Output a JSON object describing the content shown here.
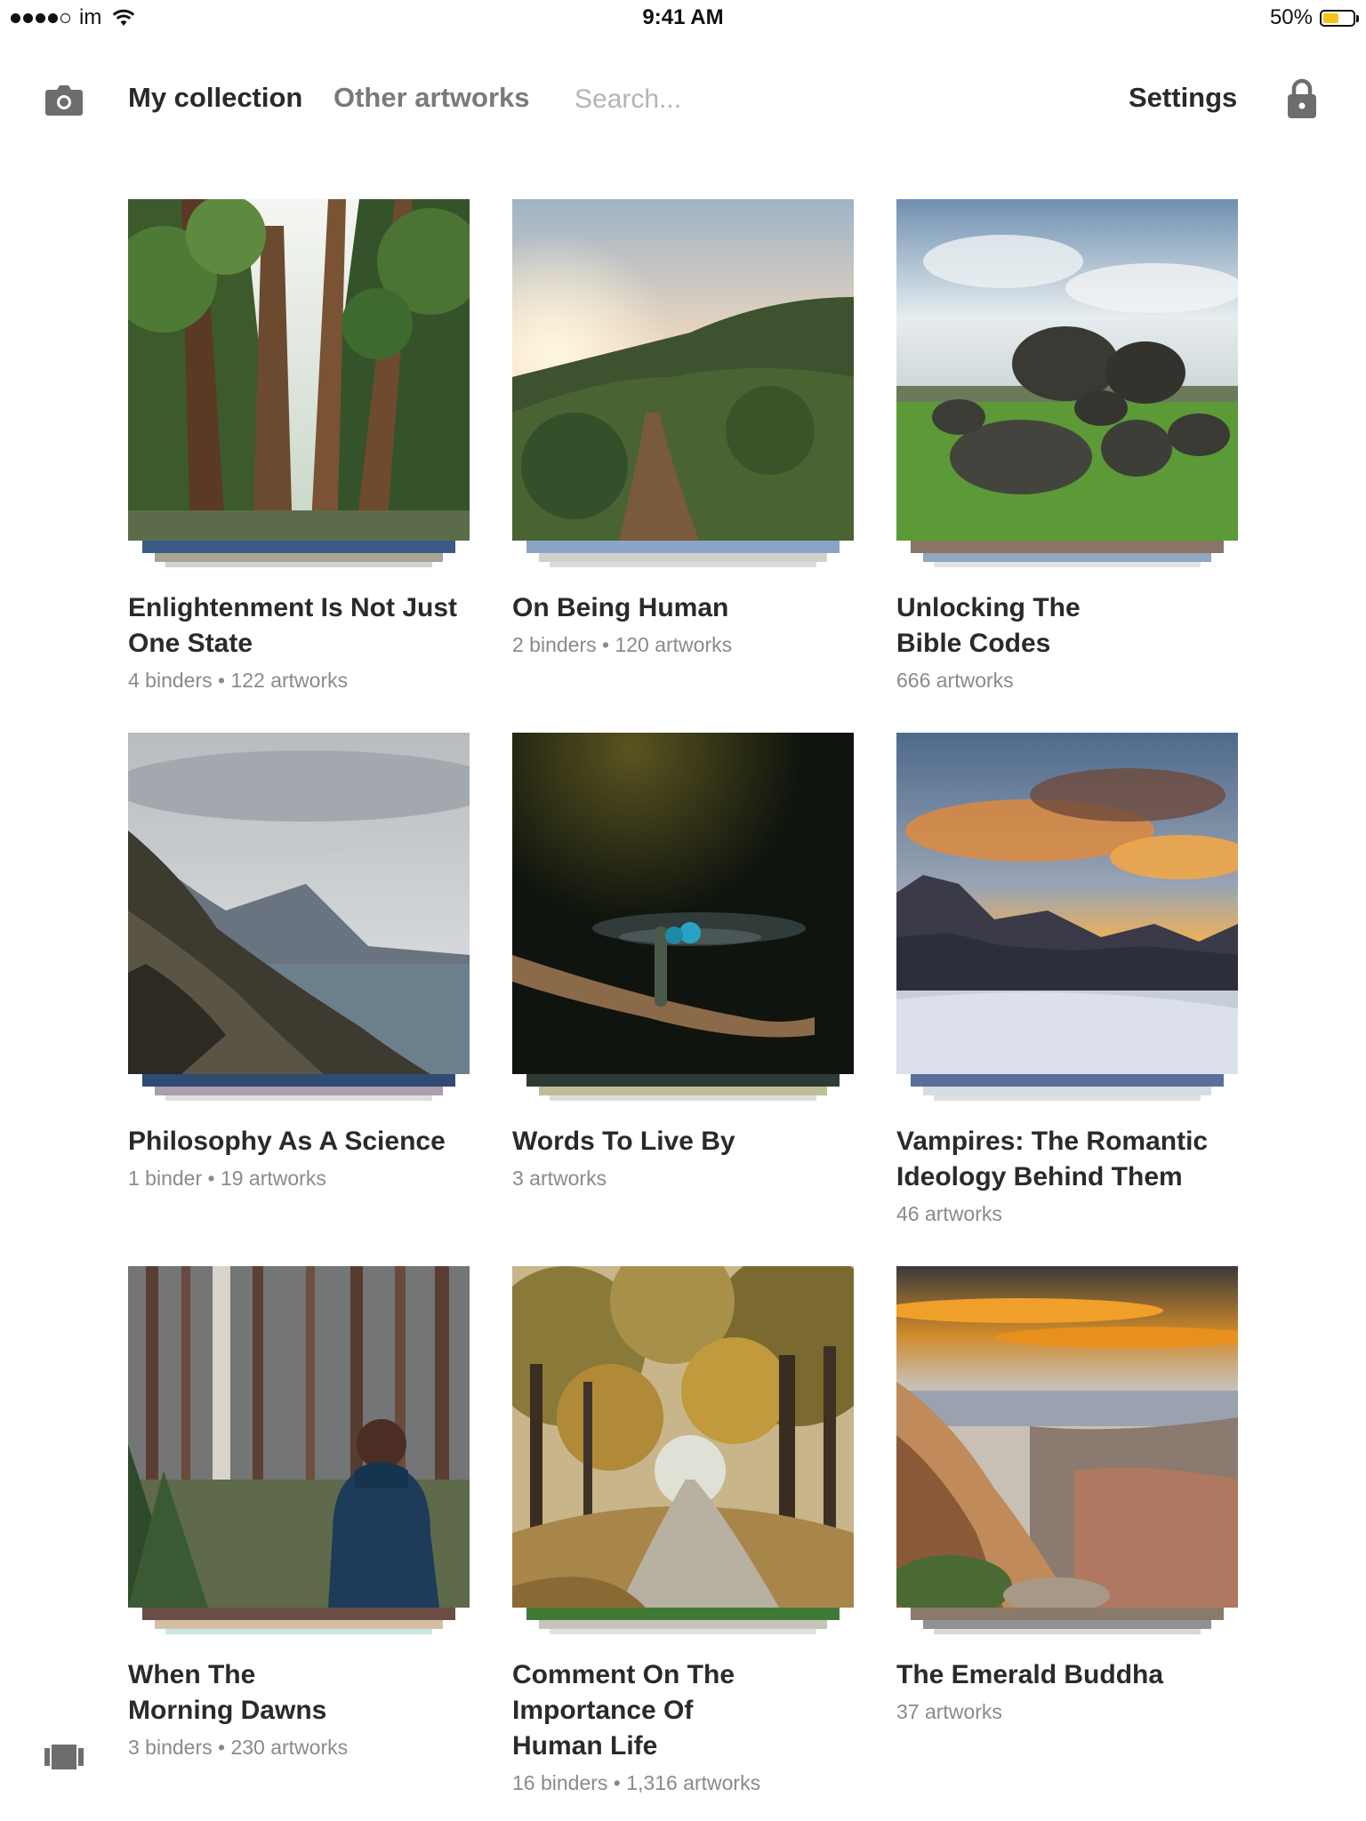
{
  "status_bar": {
    "carrier": "im",
    "time": "9:41 AM",
    "battery": "50%",
    "battery_level": 0.5
  },
  "nav": {
    "camera_icon": "camera-icon",
    "tabs": [
      {
        "label": "My collection",
        "active": true
      },
      {
        "label": "Other artworks",
        "active": false
      }
    ],
    "search_placeholder": "Search...",
    "settings_label": "Settings",
    "lock_icon": "lock-icon"
  },
  "collections": [
    {
      "title": "Enlightenment Is Not Just One State",
      "meta": "4 binders • 122 artworks",
      "image": "forest-pines"
    },
    {
      "title": "On Being Human",
      "meta": "2 binders • 120 artworks",
      "image": "trail-sunset"
    },
    {
      "title": "Unlocking The Bible Codes",
      "meta": "666 artworks",
      "image": "dolmen-stones"
    },
    {
      "title": "Philosophy As A Science",
      "meta": "1 binder • 19 artworks",
      "image": "coastal-cliffs"
    },
    {
      "title": "Words To Live By",
      "meta": "3 artworks",
      "image": "dragonfly"
    },
    {
      "title": "Vampires: The Romantic Ideology Behind Them",
      "meta": "46 artworks",
      "image": "snowy-sunset"
    },
    {
      "title": "When The Morning Dawns",
      "meta": "3 binders • 230 artworks",
      "image": "woman-in-forest"
    },
    {
      "title": "Comment On The Importance Of Human Life",
      "meta": "16 binders • 1,316 artworks",
      "image": "autumn-avenue"
    },
    {
      "title": "The Emerald Buddha",
      "meta": "37 artworks",
      "image": "canyon-sunset"
    }
  ],
  "bottom_icon": "binders-icon"
}
